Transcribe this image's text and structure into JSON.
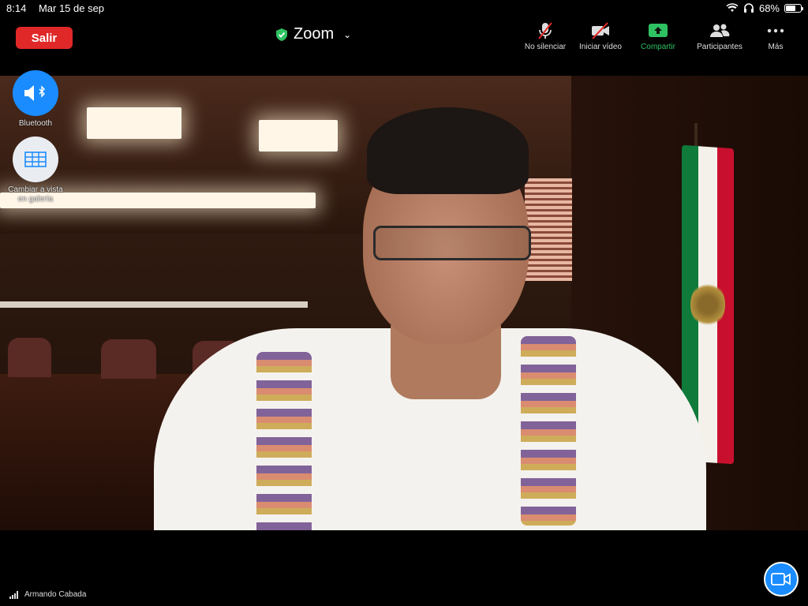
{
  "status_bar": {
    "time": "8:14",
    "date": "Mar 15 de sep",
    "battery": "68%",
    "battery_level": 0.68
  },
  "header": {
    "leave_label": "Salir",
    "app_title": "Zoom"
  },
  "toolbar": {
    "unmute_label": "No silenciar",
    "start_video_label": "Iniciar vídeo",
    "share_label": "Compartir",
    "participants_label": "Participantes",
    "more_label": "Más"
  },
  "side_controls": {
    "audio_label": "Bluetooth",
    "view_label": "Cambiar a vista en galería"
  },
  "footer": {
    "participant_name": "Armando Cabada"
  },
  "colors": {
    "leave": "#e02828",
    "share": "#2fc262",
    "accent": "#1a8cff"
  }
}
